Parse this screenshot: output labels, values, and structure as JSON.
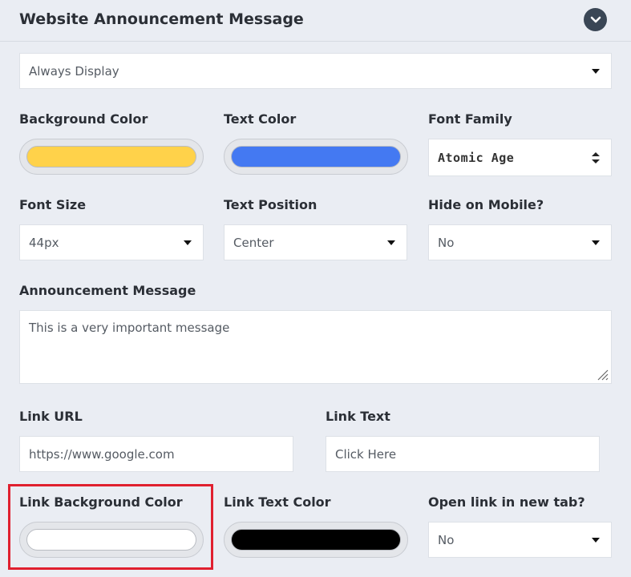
{
  "header": {
    "title": "Website Announcement Message",
    "collapse_icon": "chevron-down-icon"
  },
  "display_mode": {
    "value": "Always Display"
  },
  "background_color": {
    "label": "Background Color",
    "color": "#ffd24a"
  },
  "text_color": {
    "label": "Text Color",
    "color": "#4479f2"
  },
  "font_family": {
    "label": "Font Family",
    "value": "Atomic Age"
  },
  "font_size": {
    "label": "Font Size",
    "value": "44px"
  },
  "text_position": {
    "label": "Text Position",
    "value": "Center"
  },
  "hide_on_mobile": {
    "label": "Hide on Mobile?",
    "value": "No"
  },
  "announcement": {
    "label": "Announcement Message",
    "value": "This is a very important message"
  },
  "link_url": {
    "label": "Link URL",
    "value": "https://www.google.com"
  },
  "link_text": {
    "label": "Link Text",
    "value": "Click Here"
  },
  "link_bg_color": {
    "label": "Link Background Color",
    "color": "#ffffff"
  },
  "link_text_color": {
    "label": "Link Text Color",
    "color": "#000000"
  },
  "open_new_tab": {
    "label": "Open link in new tab?",
    "value": "No"
  },
  "highlight_color": "#e0202f"
}
